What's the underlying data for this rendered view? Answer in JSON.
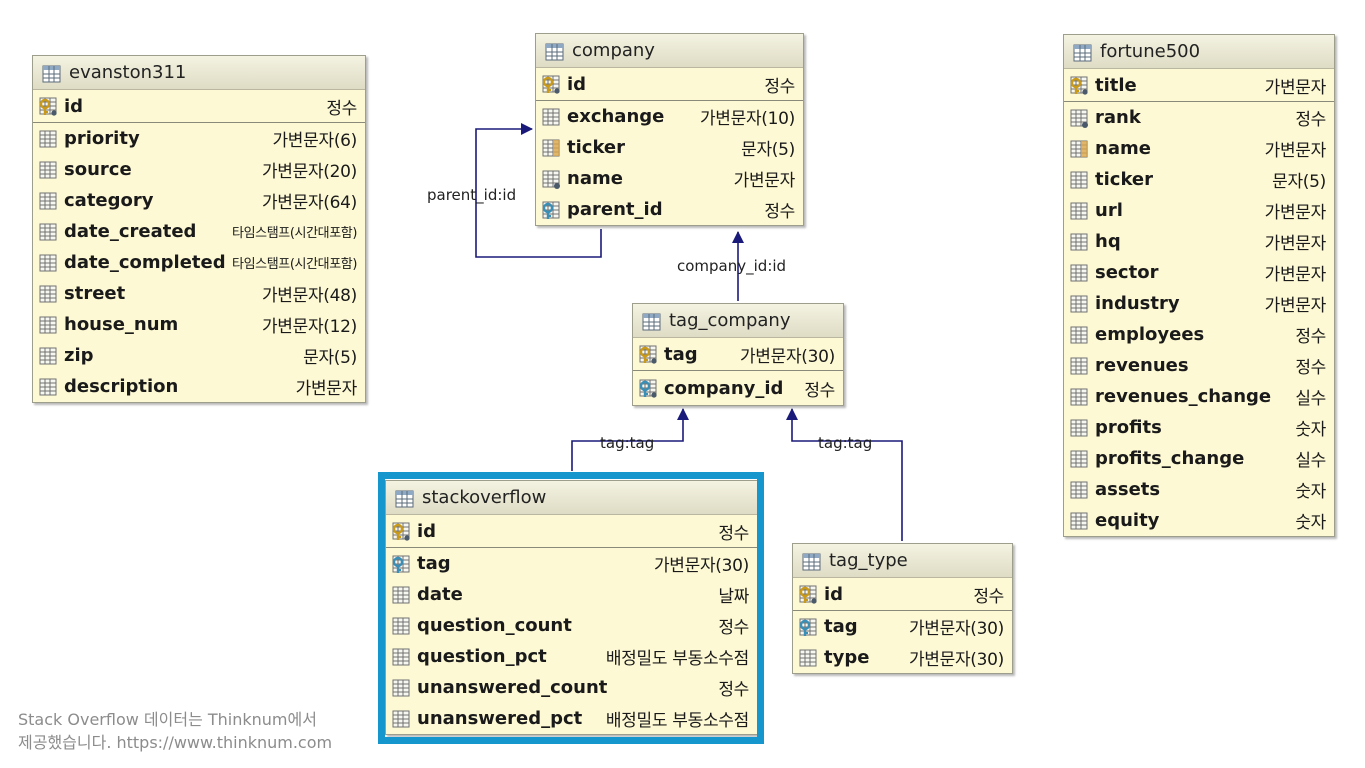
{
  "tables": {
    "evanston311": {
      "name": "evanston311",
      "pk": {
        "name": "id",
        "type": "정수"
      },
      "fields": [
        {
          "name": "priority",
          "type": "가변문자(6)"
        },
        {
          "name": "source",
          "type": "가변문자(20)"
        },
        {
          "name": "category",
          "type": "가변문자(64)"
        },
        {
          "name": "date_created",
          "type": "타임스탬프(시간대포함)"
        },
        {
          "name": "date_completed",
          "type": "타임스탬프(시간대포함)"
        },
        {
          "name": "street",
          "type": "가변문자(48)"
        },
        {
          "name": "house_num",
          "type": "가변문자(12)"
        },
        {
          "name": "zip",
          "type": "문자(5)"
        },
        {
          "name": "description",
          "type": "가변문자"
        }
      ]
    },
    "company": {
      "name": "company",
      "pk": {
        "name": "id",
        "type": "정수"
      },
      "fields": [
        {
          "name": "exchange",
          "type": "가변문자(10)"
        },
        {
          "name": "ticker",
          "type": "문자(5)"
        },
        {
          "name": "name",
          "type": "가변문자"
        },
        {
          "name": "parent_id",
          "type": "정수"
        }
      ]
    },
    "tag_company": {
      "name": "tag_company",
      "pk": {
        "name": "tag",
        "type": "가변문자(30)"
      },
      "pk2": {
        "name": "company_id",
        "type": "정수"
      }
    },
    "stackoverflow": {
      "name": "stackoverflow",
      "pk": {
        "name": "id",
        "type": "정수"
      },
      "fields": [
        {
          "name": "tag",
          "type": "가변문자(30)"
        },
        {
          "name": "date",
          "type": "날짜"
        },
        {
          "name": "question_count",
          "type": "정수"
        },
        {
          "name": "question_pct",
          "type": "배정밀도 부동소수점"
        },
        {
          "name": "unanswered_count",
          "type": "정수"
        },
        {
          "name": "unanswered_pct",
          "type": "배정밀도 부동소수점"
        }
      ]
    },
    "tag_type": {
      "name": "tag_type",
      "pk": {
        "name": "id",
        "type": "정수"
      },
      "fields": [
        {
          "name": "tag",
          "type": "가변문자(30)"
        },
        {
          "name": "type",
          "type": "가변문자(30)"
        }
      ]
    },
    "fortune500": {
      "name": "fortune500",
      "pk": {
        "name": "title",
        "type": "가변문자"
      },
      "fields": [
        {
          "name": "rank",
          "type": "정수"
        },
        {
          "name": "name",
          "type": "가변문자"
        },
        {
          "name": "ticker",
          "type": "문자(5)"
        },
        {
          "name": "url",
          "type": "가변문자"
        },
        {
          "name": "hq",
          "type": "가변문자"
        },
        {
          "name": "sector",
          "type": "가변문자"
        },
        {
          "name": "industry",
          "type": "가변문자"
        },
        {
          "name": "employees",
          "type": "정수"
        },
        {
          "name": "revenues",
          "type": "정수"
        },
        {
          "name": "revenues_change",
          "type": "실수"
        },
        {
          "name": "profits",
          "type": "숫자"
        },
        {
          "name": "profits_change",
          "type": "실수"
        },
        {
          "name": "assets",
          "type": "숫자"
        },
        {
          "name": "equity",
          "type": "숫자"
        }
      ]
    }
  },
  "relations": {
    "parent": "parent_id:id",
    "company_id": "company_id:id",
    "tag_left": "tag:tag",
    "tag_right": "tag:tag"
  },
  "footer": {
    "line1": "Stack Overflow 데이터는 Thinknum에서",
    "line2": "제공했습니다. https://www.thinknum.com"
  },
  "colors": {
    "table_bg": "#fdf9d4",
    "header_bg": "#dedcc4",
    "line": "#1a1a7a",
    "highlight": "#1596cc"
  }
}
